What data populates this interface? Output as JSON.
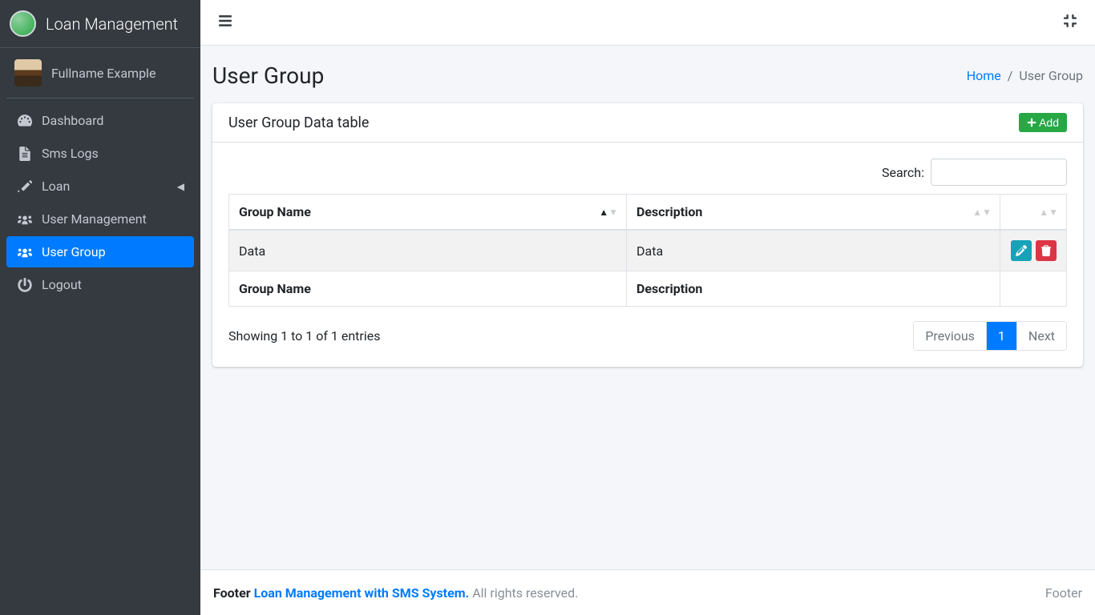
{
  "brand": {
    "title": "Loan Management"
  },
  "user": {
    "fullname": "Fullname Example"
  },
  "sidebar": {
    "items": [
      {
        "label": "Dashboard"
      },
      {
        "label": "Sms Logs"
      },
      {
        "label": "Loan"
      },
      {
        "label": "User Management"
      },
      {
        "label": "User Group"
      },
      {
        "label": "Logout"
      }
    ]
  },
  "header": {
    "page_title": "User Group",
    "breadcrumb": {
      "home": "Home",
      "current": "User Group"
    }
  },
  "card": {
    "title": "User Group Data table",
    "add_label": "Add"
  },
  "table": {
    "search_label": "Search:",
    "search_value": "",
    "columns": {
      "c0": "Group Name",
      "c1": "Description",
      "c2": ""
    },
    "footer": {
      "c0": "Group Name",
      "c1": "Description",
      "c2": ""
    },
    "rows": [
      {
        "group_name": "Data",
        "description": "Data"
      }
    ],
    "info": "Showing 1 to 1 of 1 entries",
    "pagination": {
      "prev": "Previous",
      "page": "1",
      "next": "Next"
    }
  },
  "footer": {
    "prefix": "Footer ",
    "link": "Loan Management with SMS System.",
    "rights": " All rights reserved.",
    "right": "Footer"
  }
}
